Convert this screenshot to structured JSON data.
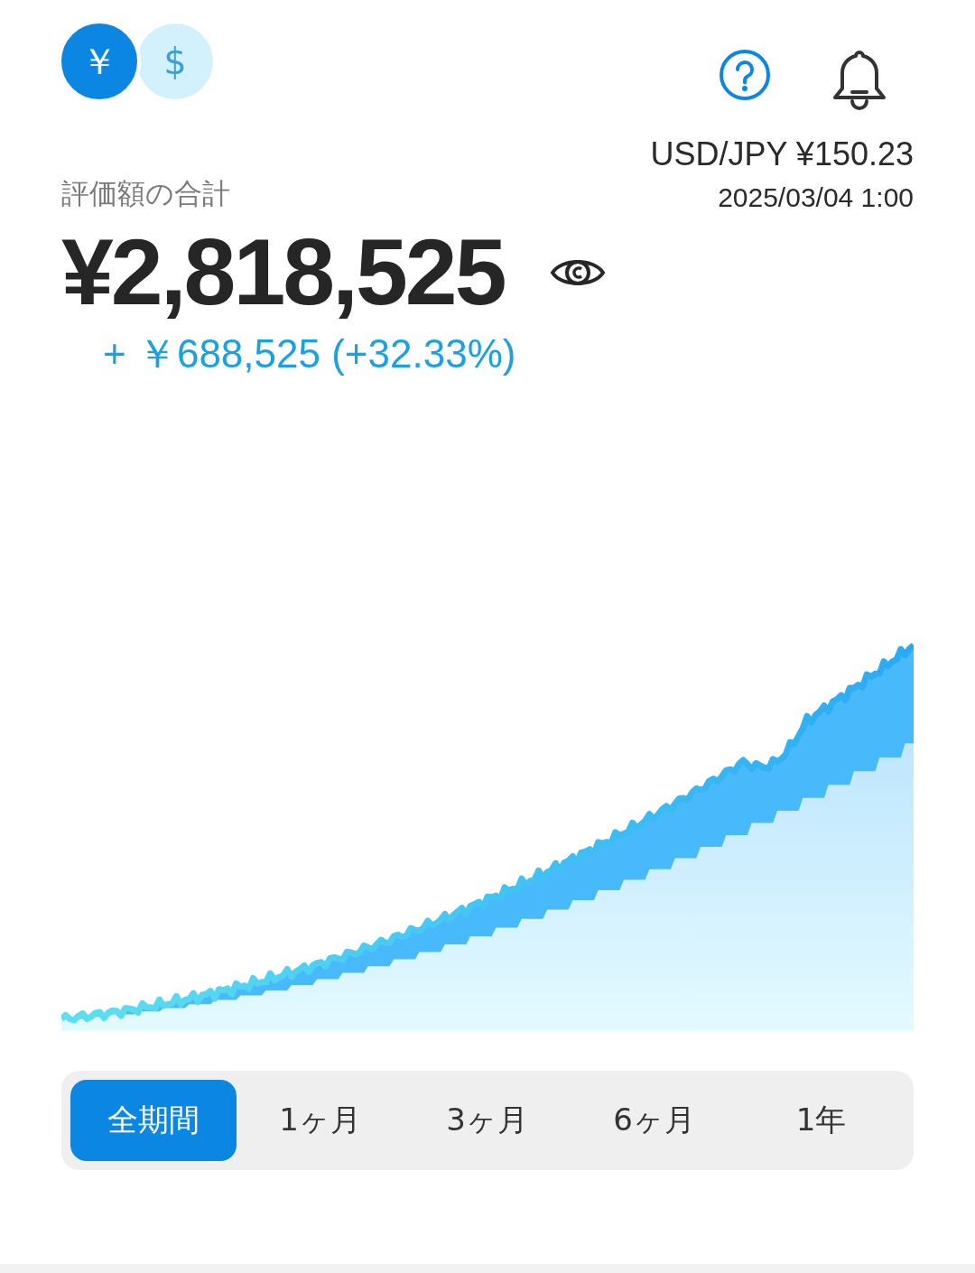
{
  "currency_toggle": [
    {
      "symbol": "￥",
      "selected": true
    },
    {
      "symbol": "$",
      "selected": false
    }
  ],
  "header_icons": [
    {
      "kind": "help"
    },
    {
      "kind": "bell"
    }
  ],
  "fx_rate": "USD/JPY ¥150.23",
  "updated_at": "2025/03/04 1:00",
  "total_label": "評価額の合計",
  "total_value": "¥2,818,525",
  "gain": "+ ￥688,525 (+32.33%)",
  "period_tabs": [
    {
      "label": "全期間",
      "selected": true
    },
    {
      "label": "1ヶ月",
      "selected": false
    },
    {
      "label": "3ヶ月",
      "selected": false
    },
    {
      "label": "6ヶ月",
      "selected": false
    },
    {
      "label": "1年",
      "selected": false
    }
  ]
}
